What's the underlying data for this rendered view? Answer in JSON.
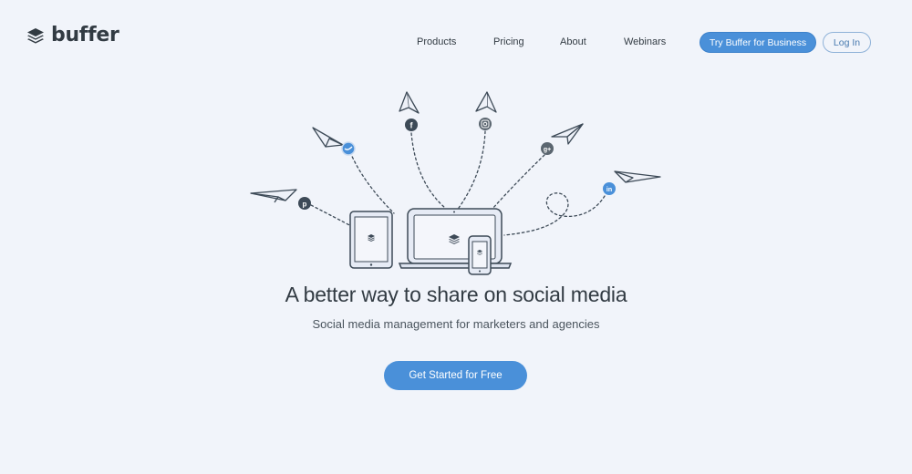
{
  "colors": {
    "background": "#f1f4fa",
    "accent": "#4a90d9",
    "text": "#323b43"
  },
  "header": {
    "brand": "buffer",
    "nav": [
      "Products",
      "Pricing",
      "About",
      "Webinars"
    ],
    "cta_business": "Try Buffer for Business",
    "login": "Log In"
  },
  "hero": {
    "headline": "A better way to share on social media",
    "subheadline": "Social media management for marketers and agencies",
    "cta": "Get Started for Free"
  },
  "illustration": {
    "network_icons": [
      "facebook-icon",
      "instagram-icon",
      "twitter-icon",
      "google-plus-icon",
      "pinterest-icon",
      "linkedin-icon"
    ]
  }
}
